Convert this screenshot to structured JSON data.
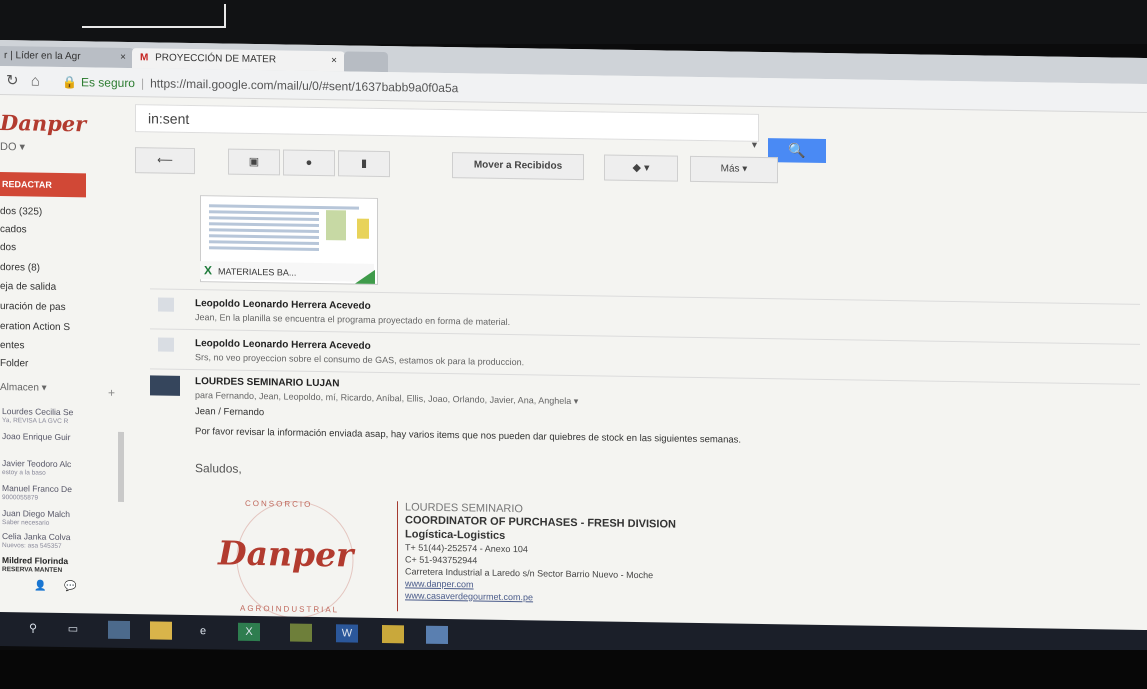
{
  "browser": {
    "tabs": [
      {
        "label": "r | Líder en la Agr"
      },
      {
        "label": "PROYECCIÓN DE MATER"
      }
    ],
    "tab_close": "×",
    "tab_icon": "M",
    "secure_label": "Es seguro",
    "url": "https://mail.google.com/mail/u/0/#sent/1637babb9a0f0a5a"
  },
  "gmail": {
    "logo": "Danper",
    "search_query": "in:sent",
    "account_label": "DO ▾",
    "toolbar": {
      "move_inbox": "Mover a Recibidos",
      "more": "Más ▾"
    },
    "compose_label": "REDACTAR",
    "sidebar": [
      {
        "label": "dos (325)"
      },
      {
        "label": "cados"
      },
      {
        "label": "dos"
      },
      {
        "label": "dores (8)"
      },
      {
        "label": "eja de salida"
      },
      {
        "label": "uración de pas"
      },
      {
        "label": "eration Action S"
      },
      {
        "label": "entes"
      },
      {
        "label": "Folder"
      },
      {
        "label": "Almacen ▾"
      }
    ],
    "chat": [
      {
        "name": "Lourdes Cecilia Se",
        "sub": "Ya, REVISA LA GVC R"
      },
      {
        "name": "Joao Enrique Guir"
      },
      {
        "name": "Javier Teodoro Alc",
        "sub": "estoy a la baso"
      },
      {
        "name": "Manuel Franco De",
        "sub": "9000055879"
      },
      {
        "name": "Juan Diego Malch",
        "sub": "Saber necesario"
      },
      {
        "name": "Celia Janka Colva",
        "sub": "Nuevos: asa 545357"
      },
      {
        "name": "Mildred Florinda",
        "sub": "RESERVA MANTEN"
      }
    ]
  },
  "attachment": {
    "filename": "MATERIALES BA..."
  },
  "messages": [
    {
      "sender": "Leopoldo Leonardo Herrera Acevedo",
      "snippet": "Jean, En la planilla se encuentra el programa proyectado en forma de material."
    },
    {
      "sender": "Leopoldo Leonardo Herrera Acevedo",
      "snippet": "Srs, no veo proyeccion sobre el consumo de GAS, estamos ok para la produccion."
    },
    {
      "sender": "LOURDES SEMINARIO LUJAN",
      "recipients": "para Fernando, Jean, Leopoldo, mí, Ricardo, Aníbal, Ellis, Joao, Orlando, Javier, Ana, Anghela ▾",
      "salutation": "Jean / Fernando",
      "body": "Por favor revisar la información enviada asap, hay varios items que nos pueden dar quiebres de stock en las siguientes semanas."
    }
  ],
  "greeting": "Saludos,",
  "signature": {
    "logo": "Danper",
    "ring_top": "CONSORCIO",
    "ring_bottom": "AGROINDUSTRIAL",
    "name": "LOURDES SEMINARIO",
    "title": "COORDINATOR OF PURCHASES -  FRESH DIVISION",
    "department": "Logística-Logistics",
    "phone": "T+ 51(44)-252574 - Anexo 104",
    "cell": "C+ 51-943752944",
    "address": "Carretera Industrial a Laredo s/n  Sector Barrio Nuevo - Moche",
    "web1": "www.danper.com",
    "web2": "www.casaverdegourmet.com.pe"
  },
  "colors": {
    "gmail_red": "#d14836",
    "search_blue": "#4a8af4",
    "danper_red": "#b23b2f",
    "excel_green": "#1d7a3a"
  }
}
